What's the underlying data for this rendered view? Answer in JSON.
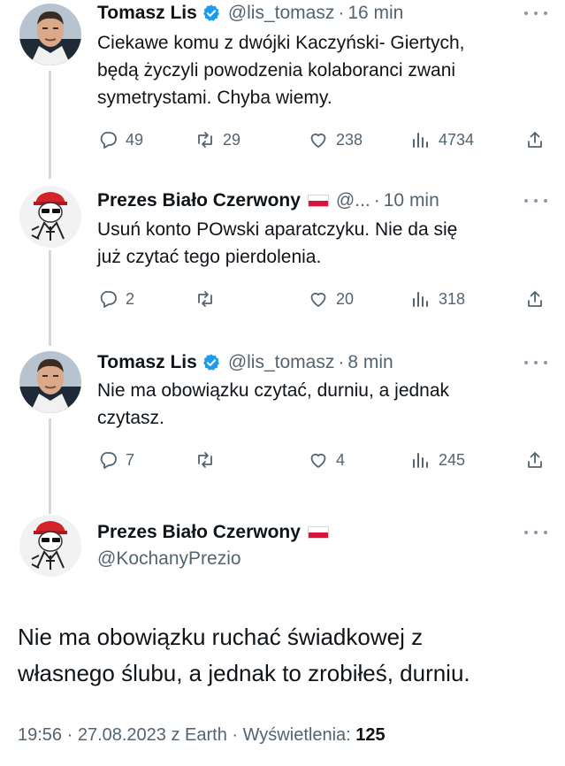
{
  "tweets": [
    {
      "name": "Tomasz Lis",
      "handle": "@lis_tomasz",
      "time": "16 min",
      "text_lines": [
        "Ciekawe komu z dwójki Kaczyński- Giertych,",
        "będą życzyli powodzenia kolaboranci zwani",
        "symetrystami. Chyba wiemy."
      ],
      "replies": "49",
      "retweets": "29",
      "likes": "238",
      "views": "4734"
    },
    {
      "name": "Prezes Biało Czerwony",
      "handle": "@...",
      "time": "10 min",
      "text_lines": [
        "Usuń konto POwski aparatczyku. Nie da się",
        "już czytać tego pierdolenia."
      ],
      "replies": "2",
      "retweets": "",
      "likes": "20",
      "views": "318"
    },
    {
      "name": "Tomasz Lis",
      "handle": "@lis_tomasz",
      "time": "8 min",
      "text_lines": [
        "Nie ma obowiązku czytać, durniu, a jednak",
        "czytasz."
      ],
      "replies": "7",
      "retweets": "",
      "likes": "4",
      "views": "245"
    }
  ],
  "main_tweet": {
    "name": "Prezes Biało Czerwony",
    "handle": "@KochanyPrezio",
    "text_lines": [
      "Nie ma obowiązku ruchać świadkowej z",
      "własnego ślubu, a jednak to zrobiłeś, durniu."
    ],
    "meta_prefix": "19:56 · 27.08.2023 z Earth · Wyświetlenia: ",
    "views": "125"
  },
  "colors": {
    "verified": "#1d9bf0",
    "text": "#0f1419",
    "muted": "#536471",
    "thread_line": "#cfd9de",
    "flag_red": "#dc143c"
  },
  "icons": [
    "verified-badge-icon",
    "poland-flag-icon",
    "more-icon",
    "reply-icon",
    "retweet-icon",
    "like-icon",
    "views-icon",
    "share-icon"
  ]
}
